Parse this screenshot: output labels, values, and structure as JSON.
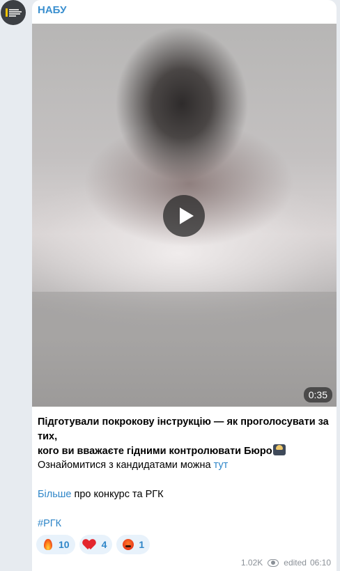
{
  "channel": {
    "name": "НАБУ",
    "avatar": "nabu-logo-icon"
  },
  "video": {
    "duration": "0:35",
    "play_icon": "play-icon"
  },
  "message": {
    "line1": "Підготували покрокову інструкцію — як проголосувати за тих,",
    "line2": "кого ви вважаєте гідними контролювати Бюро",
    "line2_emoji": "technologist-emoji-icon",
    "candidates_text": "Ознайомитися з кандидатами можна ",
    "candidates_link": "тут",
    "more_link": "Більше",
    "more_text": " про конкурс та РГК",
    "hashtag": "#РГК"
  },
  "reactions": [
    {
      "icon": "fire-icon",
      "count": "10"
    },
    {
      "icon": "heart-icon",
      "count": "4"
    },
    {
      "icon": "angry-face-icon",
      "count": "1"
    }
  ],
  "footer": {
    "views": "1.02K",
    "views_icon": "eye-icon",
    "edited_label": "edited",
    "time": "06:10"
  },
  "colors": {
    "accent": "#2f86c8",
    "sender": "#3a8fcf",
    "background": "#e7ebf0"
  }
}
